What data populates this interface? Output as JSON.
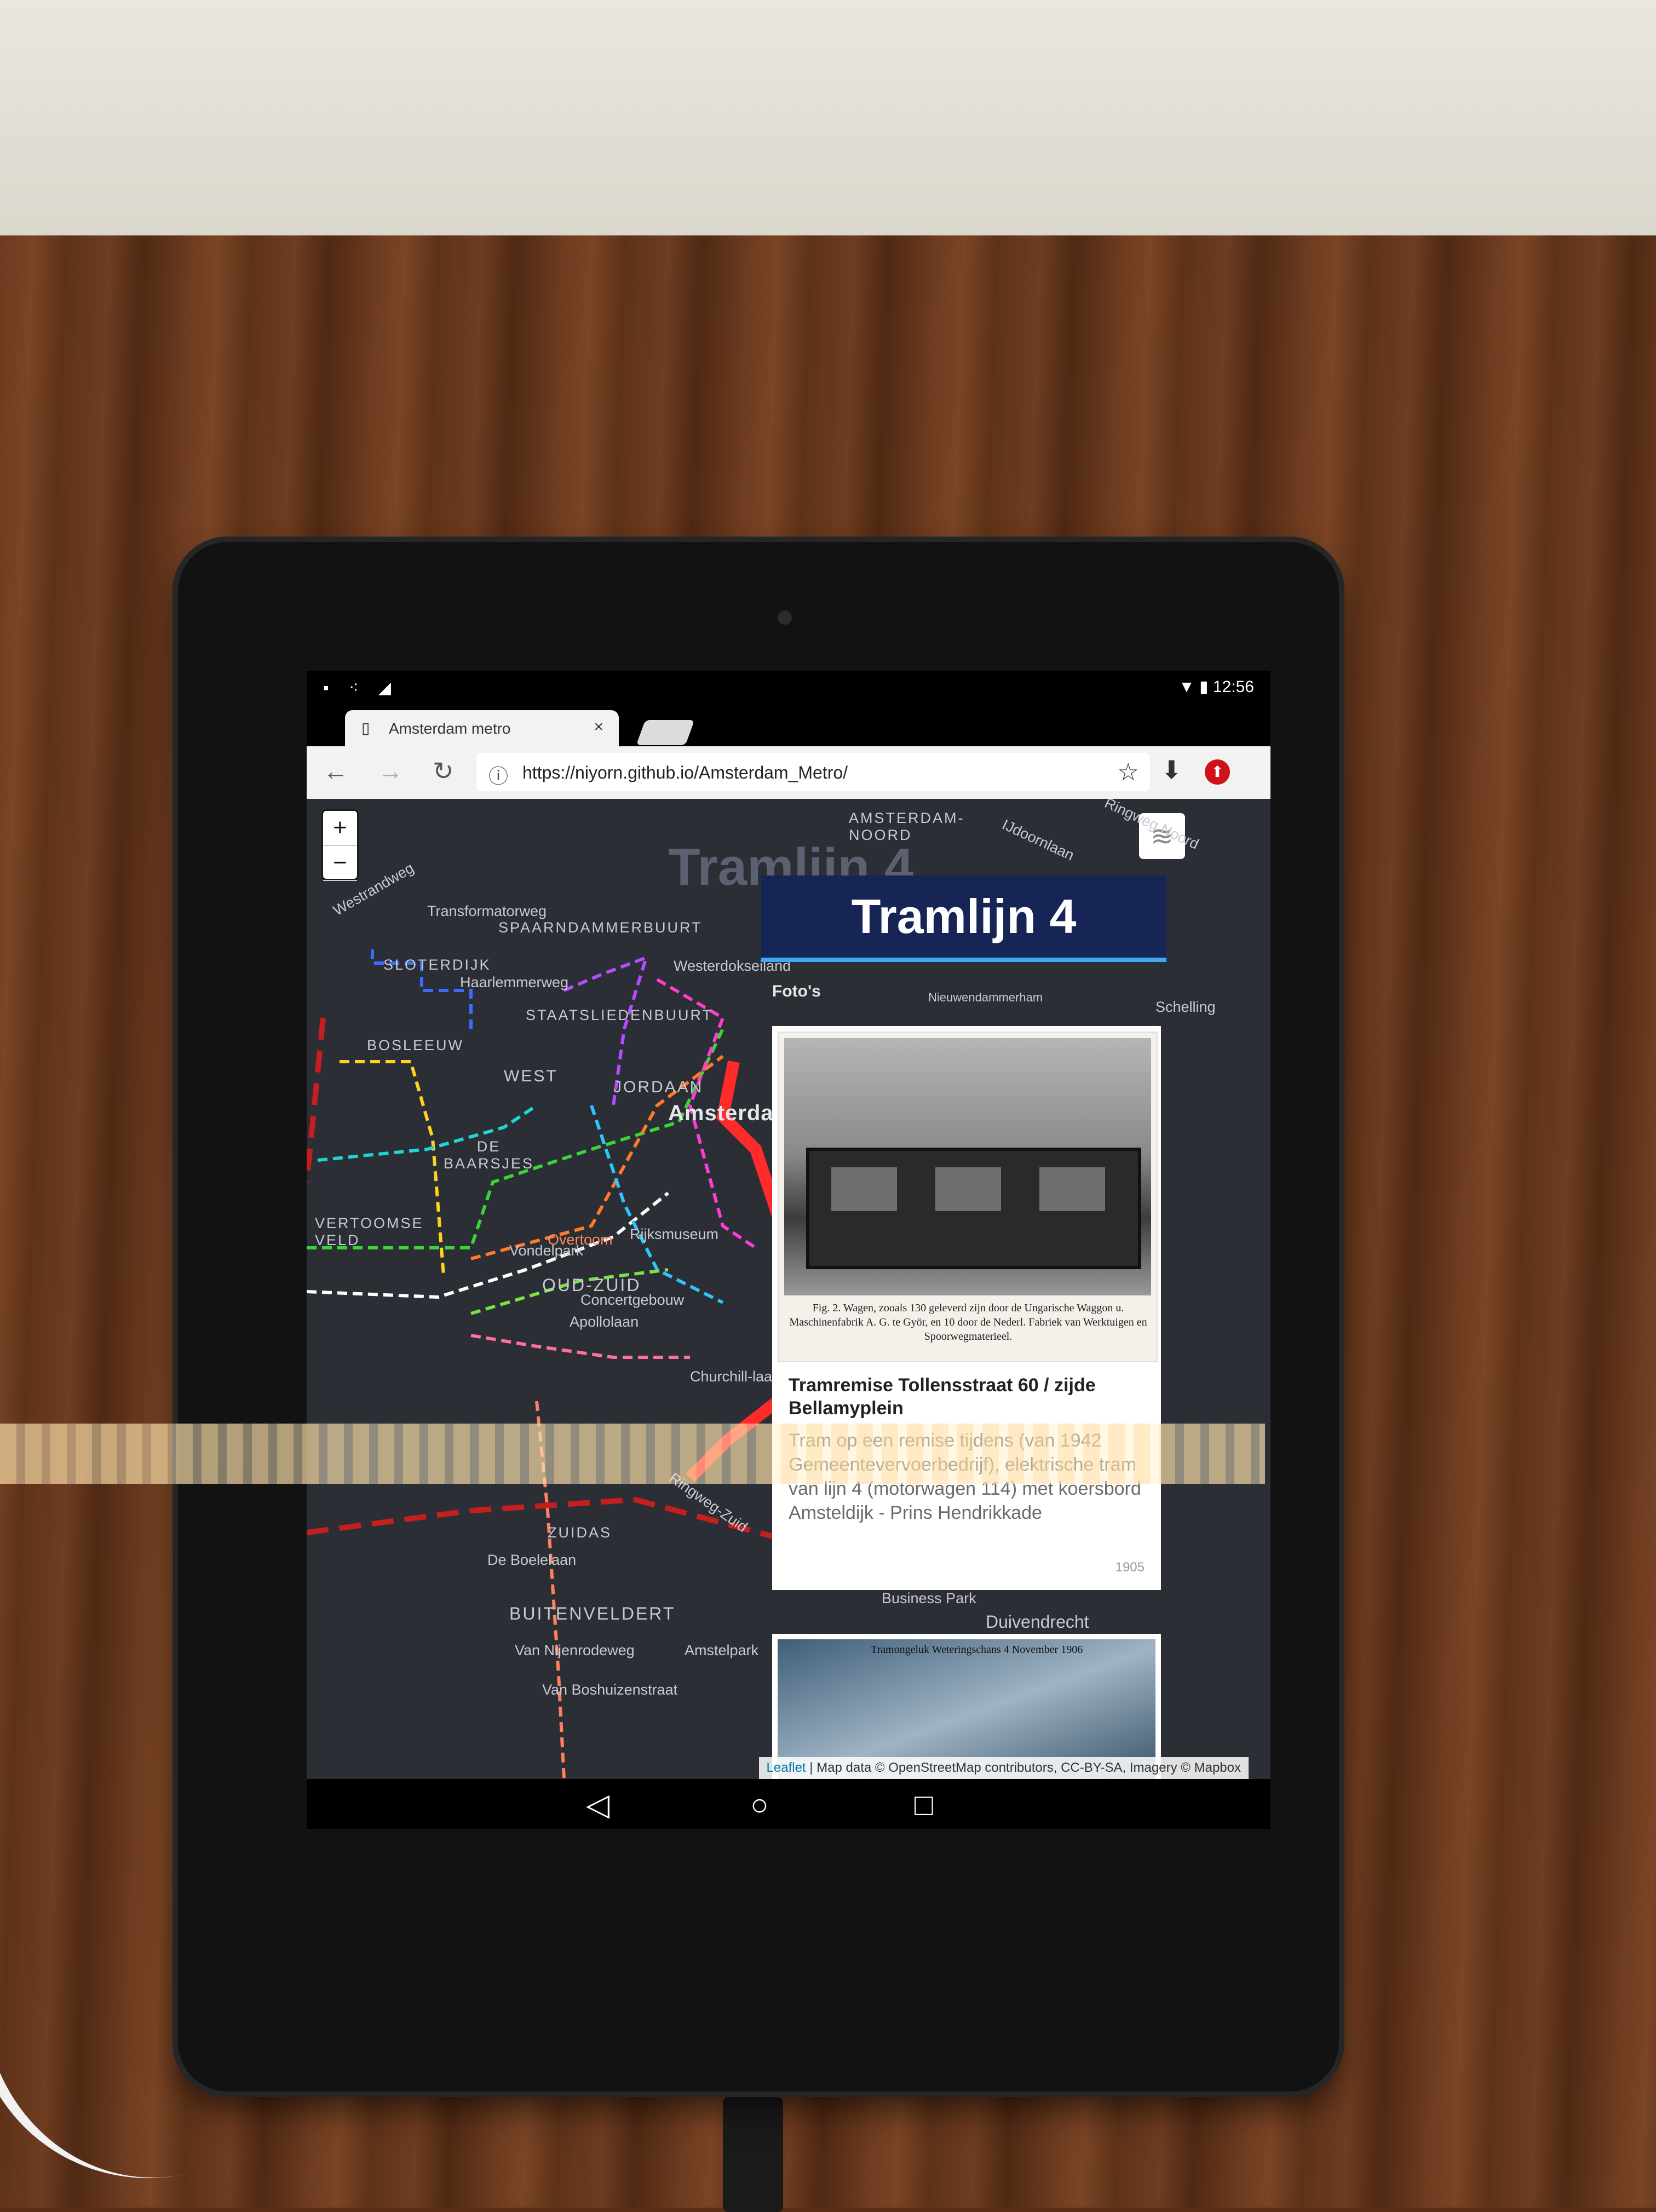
{
  "status_bar": {
    "left_icons": "▪ ⁖ ◢",
    "right": "▼ ▮ 12:56"
  },
  "browser": {
    "tab_title": "Amsterdam metro",
    "tab_close": "×",
    "url": "https://niyorn.github.io/Amsterdam_Metro/",
    "back": "←",
    "forward": "→",
    "reload": "↻",
    "info": "ⓘ",
    "star": "☆",
    "download": "⬇",
    "extension": "⬆"
  },
  "map": {
    "zoom_in": "+",
    "zoom_out": "−",
    "layers_icon": "≋",
    "ghost_title": "Tramlijn 4",
    "labels": {
      "amsterdam_noord": "AMSTERDAM-\nNOORD",
      "spaarndammerbuurt": "SPAARNDAMMERBUURT",
      "slotermeer": "SLOTERDIJK",
      "staatslieden": "STAATSLIEDENBUURT",
      "bos_en_lommer": "BOSLEEUW",
      "west": "WEST",
      "jordaan": "JORDAAN",
      "amsterdam": "Amsterdam",
      "de_baarsjes": "DE\nBAARSJES",
      "vondelpark": "Vondelpark",
      "overtoomse": "VERTOOMSE\nVELD",
      "oud_zuid": "OUD-ZUID",
      "apollolaan": "Apollolaan",
      "zuidas": "ZUIDAS",
      "de_boelelaan": "De Boelelaan",
      "buitenveldert": "BUITENVELDERT",
      "amstelpark": "Amstelpark",
      "van_nijenrode": "Van Nijenrodeweg",
      "van_boshuizen": "Van Boshuizenstraat",
      "duivendrecht": "Duivendrecht",
      "westerdokseiland": "Westerdokseiland",
      "haarlemmerweg": "Haarlemmerweg",
      "transformatorweg": "Transformatorweg",
      "westrandweg": "Westrandweg",
      "rijksmuseum": "Rijksmuseum",
      "concertgebouw": "Concertgebouw",
      "churchill": "Churchill-laan",
      "ringweg_zuid": "Ringweg-Zuid",
      "overtoom": "Overtoom",
      "nieuwendammerham": "Nieuwendammerham",
      "schellingwoude": "Schelling",
      "ijdoornlaan": "IJdoornlaan",
      "business_park": "Business Park",
      "ringweg_noord": "Ringweg Noord"
    },
    "attribution": {
      "leaflet": "Leaflet",
      "text": "| Map data © OpenStreetMap contributors, CC-BY-SA, Imagery © Mapbox"
    }
  },
  "panel": {
    "title": "Tramlijn 4",
    "section": "Foto's",
    "card": {
      "photo_caption": "Fig. 2. Wagen, zooals 130 geleverd zijn door de Ungarische Waggon u. Maschinenfabrik A. G. te Györ, en 10 door de Nederl. Fabriek van Werktuigen en Spoorwegmaterieel.",
      "title": "Tramremise Tollensstraat 60 / zijde Bellamyplein",
      "body": "Tram op een remise tijdens (van 1942 Gemeentevervoerbedrijf), elektrische tram van lijn 4 (motorwagen 114) met koersbord Amsteldijk - Prins Hendrikkade",
      "year": "1905"
    },
    "card2": {
      "caption": "Tramongeluk Weteringschans 4 November 1906"
    }
  },
  "nav_bar": {
    "back": "◁",
    "home": "○",
    "recents": "□"
  },
  "colors": {
    "panel_header": "#162456",
    "panel_accent": "#3fa9f5",
    "map_bg": "#2b2e35",
    "tram4_line": "#ff2a2a"
  }
}
